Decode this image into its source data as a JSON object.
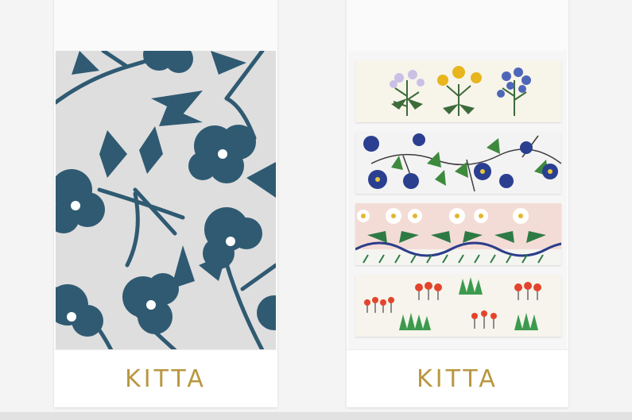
{
  "products": [
    {
      "brand": "KITTA",
      "design": "blue-floral-pattern"
    },
    {
      "brand": "KITTA",
      "design": "four-flower-tape-strips"
    }
  ],
  "colors": {
    "brand_gold": "#b8973f",
    "floral_blue": "#2f5a72",
    "floral_background": "#dedede"
  }
}
